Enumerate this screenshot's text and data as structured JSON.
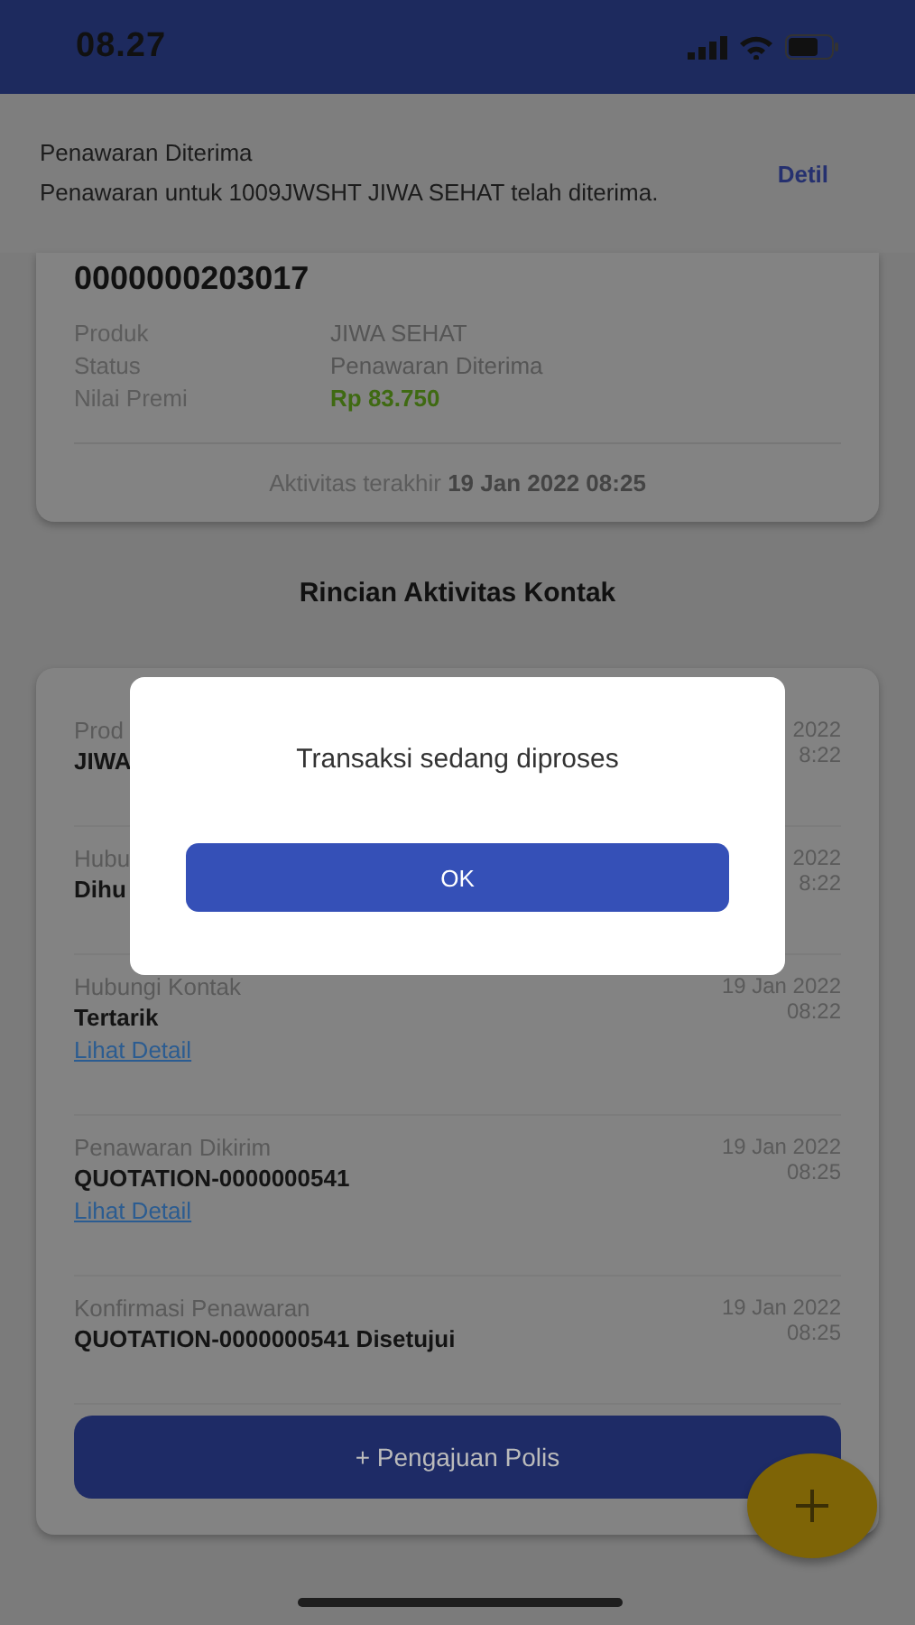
{
  "status_bar": {
    "time": "08.27"
  },
  "notification": {
    "title": "Penawaran Diterima",
    "message": "Penawaran untuk 1009JWSHT JIWA SEHAT telah diterima.",
    "action": "Detil"
  },
  "summary": {
    "number": "0000000203017",
    "fields": [
      {
        "label": "Produk",
        "value": "JIWA SEHAT",
        "kind": "text"
      },
      {
        "label": "Status",
        "value": "Penawaran Diterima",
        "kind": "text"
      },
      {
        "label": "Nilai Premi",
        "value": "Rp 83.750",
        "kind": "money"
      }
    ],
    "last_activity": {
      "label": "Aktivitas terakhir",
      "value": "19 Jan 2022 08:25"
    }
  },
  "section_title": "Rincian Aktivitas Kontak",
  "activities": [
    {
      "title": "Prod",
      "value": "JIWA",
      "date": "2022",
      "time": "8:22"
    },
    {
      "title": "Hubu",
      "value": "Dihu",
      "date": "2022",
      "time": "8:22"
    },
    {
      "title": "Hubungi Kontak",
      "value": "Tertarik",
      "date": "19 Jan 2022",
      "time": "08:22",
      "link": "Lihat Detail"
    },
    {
      "title": "Penawaran Dikirim",
      "value": "QUOTATION-0000000541",
      "date": "19 Jan 2022",
      "time": "08:25",
      "link": "Lihat Detail"
    },
    {
      "title": "Konfirmasi Penawaran",
      "value": "QUOTATION-0000000541 Disetujui",
      "date": "19 Jan 2022",
      "time": "08:25"
    }
  ],
  "primary_button": "+ Pengajuan Polis",
  "dialog": {
    "message": "Transaksi sedang diproses",
    "button": "OK"
  }
}
